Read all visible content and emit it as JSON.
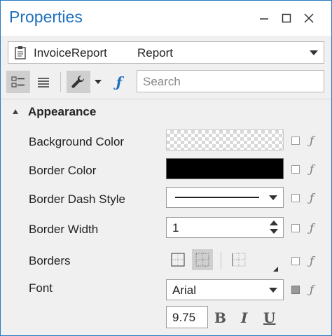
{
  "window": {
    "title": "Properties"
  },
  "object_selector": {
    "name": "InvoiceReport",
    "type": "Report"
  },
  "search": {
    "placeholder": "Search"
  },
  "category": {
    "label": "Appearance"
  },
  "properties": {
    "background_color": {
      "label": "Background Color"
    },
    "border_color": {
      "label": "Border Color",
      "value_color": "#000000"
    },
    "border_dash_style": {
      "label": "Border Dash Style"
    },
    "border_width": {
      "label": "Border Width",
      "value": "1"
    },
    "borders": {
      "label": "Borders"
    },
    "font": {
      "label": "Font",
      "family": "Arial",
      "size": "9.75",
      "bold": "B",
      "italic": "I",
      "underline": "U"
    }
  },
  "icons": {
    "fx_glyph": "ƒ",
    "minimize": "─",
    "maximize": "☐",
    "close": "✕"
  },
  "colors": {
    "title": "#1e6fbf",
    "border": "#2b79c2"
  }
}
